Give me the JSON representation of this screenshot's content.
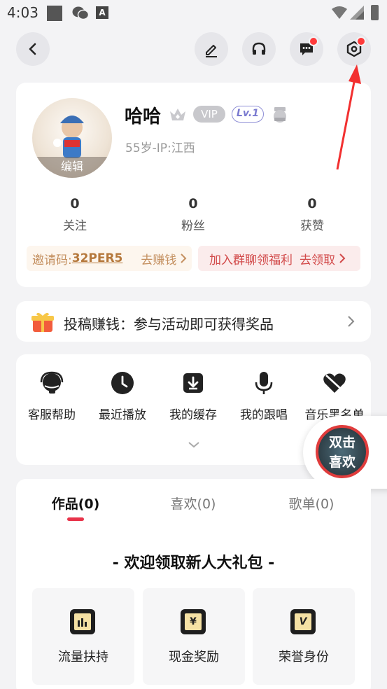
{
  "status_bar": {
    "time": "4:03",
    "a_icon_text": "A"
  },
  "profile": {
    "name": "哈哈",
    "vip": "VIP",
    "level": "Lv.1",
    "meta": "55岁-IP:江西",
    "avatar_edit": "编辑"
  },
  "stats": [
    {
      "value": "0",
      "label": "关注"
    },
    {
      "value": "0",
      "label": "粉丝"
    },
    {
      "value": "0",
      "label": "获赞"
    }
  ],
  "invite": {
    "label": "邀请码:",
    "code": "32PER5",
    "action": "去赚钱"
  },
  "group": {
    "label": "加入群聊领福利",
    "action": "去领取"
  },
  "banner": {
    "text": "投稿赚钱：参与活动即可获得奖品"
  },
  "tools": [
    {
      "label": "客服帮助",
      "icon": "headset-agent-icon"
    },
    {
      "label": "最近播放",
      "icon": "clock-icon"
    },
    {
      "label": "我的缓存",
      "icon": "download-icon"
    },
    {
      "label": "我的跟唱",
      "icon": "microphone-icon"
    },
    {
      "label": "音乐黑名单",
      "icon": "broken-heart-icon"
    }
  ],
  "floating": {
    "line1": "双击",
    "line2": "喜欢"
  },
  "tabs": [
    {
      "label": "作品(0)",
      "active": true
    },
    {
      "label": "喜欢(0)",
      "active": false
    },
    {
      "label": "歌单(0)",
      "active": false
    }
  ],
  "gift": {
    "title": "- 欢迎领取新人大礼包 -",
    "items": [
      {
        "label": "流量扶持",
        "icon": "chart-icon"
      },
      {
        "label": "现金奖励",
        "icon": "yen-icon",
        "glyph": "¥"
      },
      {
        "label": "荣誉身份",
        "icon": "badge-icon",
        "glyph": "V"
      }
    ]
  },
  "colors": {
    "accent_red": "#e8334a",
    "invite_gold": "#b5783c",
    "group_red": "#d24a4a"
  }
}
